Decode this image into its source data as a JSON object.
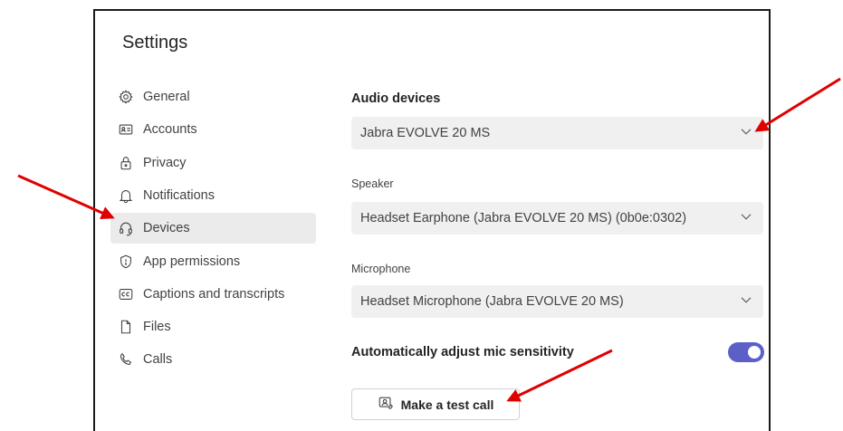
{
  "settings": {
    "title": "Settings",
    "nav": [
      {
        "label": "General",
        "icon": "gear-icon"
      },
      {
        "label": "Accounts",
        "icon": "id-card-icon"
      },
      {
        "label": "Privacy",
        "icon": "lock-icon"
      },
      {
        "label": "Notifications",
        "icon": "bell-icon"
      },
      {
        "label": "Devices",
        "icon": "headset-icon",
        "active": true
      },
      {
        "label": "App permissions",
        "icon": "shield-icon"
      },
      {
        "label": "Captions and transcripts",
        "icon": "closed-captions-icon"
      },
      {
        "label": "Files",
        "icon": "file-icon"
      },
      {
        "label": "Calls",
        "icon": "phone-icon"
      }
    ]
  },
  "devices": {
    "audio_devices_title": "Audio devices",
    "audio_device_value": "Jabra EVOLVE 20 MS",
    "speaker_label": "Speaker",
    "speaker_value": "Headset Earphone (Jabra EVOLVE 20 MS) (0b0e:0302)",
    "microphone_label": "Microphone",
    "microphone_value": "Headset Microphone (Jabra EVOLVE 20 MS)",
    "auto_adjust_label": "Automatically adjust mic sensitivity",
    "auto_adjust_on": true,
    "test_call_label": "Make a test call"
  },
  "colors": {
    "accent": "#5b5fc7",
    "annotation_arrow": "#e00000",
    "active_nav_bg": "#ebebeb",
    "dropdown_bg": "#f0f0f0"
  }
}
